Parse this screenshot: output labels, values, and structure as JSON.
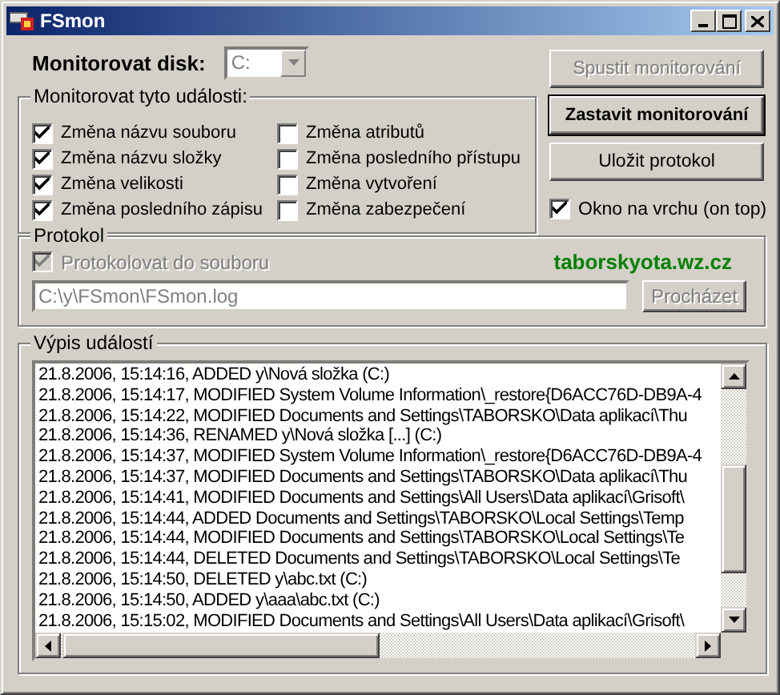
{
  "window": {
    "title": "FSmon"
  },
  "disk": {
    "label": "Monitorovat disk:",
    "value": "C:",
    "disabled": true
  },
  "events": {
    "title": "Monitorovat tyto události:",
    "items": [
      {
        "label": "Změna názvu souboru",
        "checked": true
      },
      {
        "label": "Změna názvu složky",
        "checked": true
      },
      {
        "label": "Změna velikosti",
        "checked": true
      },
      {
        "label": "Změna posledního zápisu",
        "checked": true
      },
      {
        "label": "Změna atributů",
        "checked": false
      },
      {
        "label": "Změna posledního přístupu",
        "checked": false
      },
      {
        "label": "Změna vytvoření",
        "checked": false
      },
      {
        "label": "Změna zabezpečení",
        "checked": false
      }
    ]
  },
  "buttons": [
    {
      "label": "Spustit monitorování",
      "disabled": true,
      "default": false
    },
    {
      "label": "Zastavit monitorování",
      "disabled": false,
      "default": true
    },
    {
      "label": "Uložit protokol",
      "disabled": false,
      "default": false
    }
  ],
  "on_top": {
    "label": "Okno na vrchu (on top)",
    "checked": true
  },
  "protocol": {
    "title": "Protokol",
    "log_to_file": {
      "label": "Protokolovat do souboru",
      "checked": true,
      "disabled": true
    },
    "link": "taborskyota.wz.cz",
    "path": {
      "value": "C:\\y\\FSmon\\FSmon.log",
      "disabled": true
    },
    "browse": {
      "label": "Procházet",
      "disabled": true
    }
  },
  "log": {
    "title": "Výpis událostí",
    "lines": [
      "21.8.2006, 15:14:16, ADDED y\\Nová složka (C:)",
      "21.8.2006, 15:14:17, MODIFIED System Volume Information\\_restore{D6ACC76D-DB9A-4",
      "21.8.2006, 15:14:22, MODIFIED Documents and Settings\\TABORSKO\\Data aplikací\\Thu",
      "21.8.2006, 15:14:36, RENAMED y\\Nová složka [...] (C:)",
      "21.8.2006, 15:14:37, MODIFIED System Volume Information\\_restore{D6ACC76D-DB9A-4",
      "21.8.2006, 15:14:37, MODIFIED Documents and Settings\\TABORSKO\\Data aplikací\\Thu",
      "21.8.2006, 15:14:41, MODIFIED Documents and Settings\\All Users\\Data aplikací\\Grisoft\\",
      "21.8.2006, 15:14:44, ADDED Documents and Settings\\TABORSKO\\Local Settings\\Temp",
      "21.8.2006, 15:14:44, MODIFIED Documents and Settings\\TABORSKO\\Local Settings\\Te",
      "21.8.2006, 15:14:44, DELETED Documents and Settings\\TABORSKO\\Local Settings\\Te",
      "21.8.2006, 15:14:50, DELETED y\\abc.txt (C:)",
      "21.8.2006, 15:14:50, ADDED y\\aaa\\abc.txt (C:)",
      "21.8.2006, 15:15:02, MODIFIED Documents and Settings\\All Users\\Data aplikací\\Grisoft\\"
    ]
  }
}
